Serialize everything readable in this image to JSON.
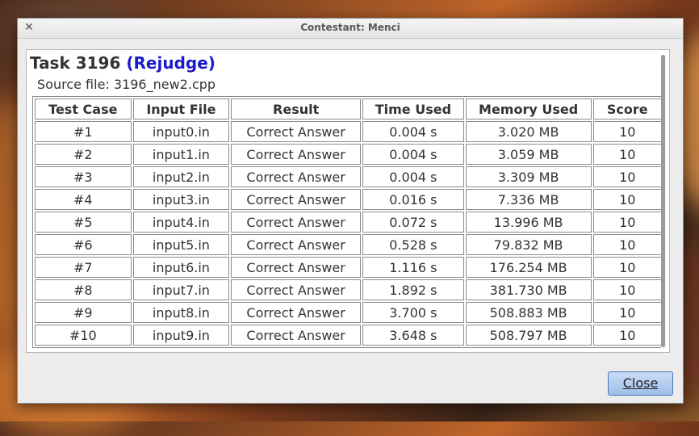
{
  "window": {
    "title": "Contestant: Menci"
  },
  "task": {
    "label": "Task 3196",
    "status": "(Rejudge)",
    "source_line": "Source file: 3196_new2.cpp"
  },
  "table": {
    "headers": [
      "Test Case",
      "Input File",
      "Result",
      "Time Used",
      "Memory Used",
      "Score"
    ],
    "rows": [
      [
        "#1",
        "input0.in",
        "Correct Answer",
        "0.004 s",
        "3.020 MB",
        "10"
      ],
      [
        "#2",
        "input1.in",
        "Correct Answer",
        "0.004 s",
        "3.059 MB",
        "10"
      ],
      [
        "#3",
        "input2.in",
        "Correct Answer",
        "0.004 s",
        "3.309 MB",
        "10"
      ],
      [
        "#4",
        "input3.in",
        "Correct Answer",
        "0.016 s",
        "7.336 MB",
        "10"
      ],
      [
        "#5",
        "input4.in",
        "Correct Answer",
        "0.072 s",
        "13.996 MB",
        "10"
      ],
      [
        "#6",
        "input5.in",
        "Correct Answer",
        "0.528 s",
        "79.832 MB",
        "10"
      ],
      [
        "#7",
        "input6.in",
        "Correct Answer",
        "1.116 s",
        "176.254 MB",
        "10"
      ],
      [
        "#8",
        "input7.in",
        "Correct Answer",
        "1.892 s",
        "381.730 MB",
        "10"
      ],
      [
        "#9",
        "input8.in",
        "Correct Answer",
        "3.700 s",
        "508.883 MB",
        "10"
      ],
      [
        "#10",
        "input9.in",
        "Correct Answer",
        "3.648 s",
        "508.797 MB",
        "10"
      ]
    ]
  },
  "buttons": {
    "close": "Close"
  },
  "icons": {
    "window_close": "close-icon"
  },
  "colors": {
    "rejudge": "#1a1acc",
    "button_border": "#4a78b8"
  }
}
